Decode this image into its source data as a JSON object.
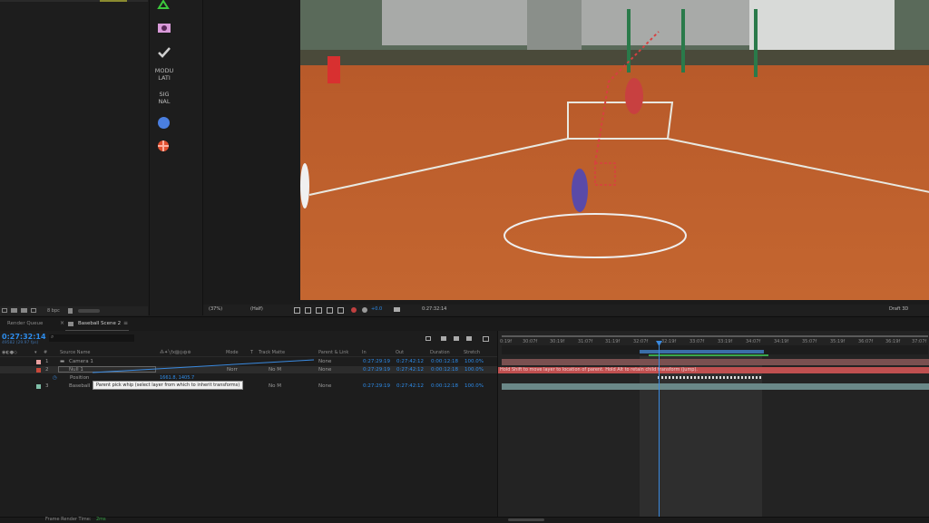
{
  "tools": {
    "labels": [
      "MODU\nLATI",
      "SIG\nNAL"
    ]
  },
  "viewer": {
    "zoom": "(37%)",
    "quality": "(Half)",
    "exposure": "+0.0",
    "timecode": "0:27:32:14",
    "renderer": "Draft 3D",
    "bpc": "8 bpc"
  },
  "tabs": {
    "render_queue": "Render Queue",
    "comp": "Baseball Scene 2"
  },
  "timeline": {
    "current_time": "0:27:32:14",
    "frame_info": "49582 (29.97 fps)",
    "columns": {
      "source_name": "Source Name",
      "mode": "Mode",
      "t": "T",
      "track_matte": "Track Matte",
      "parent": "Parent & Link",
      "in": "In",
      "out": "Out",
      "duration": "Duration",
      "stretch": "Stretch"
    },
    "layers": [
      {
        "num": "1",
        "name": "Camera 1",
        "parent": "None",
        "in": "0:27:29:19",
        "out": "0:27:42:12",
        "duration": "0:00:12:18",
        "stretch": "100.0%",
        "color": "#e8a0a0"
      },
      {
        "num": "2",
        "name": "Null 1",
        "mode": "Norr",
        "matte": "No M",
        "parent": "None",
        "in": "0:27:29:19",
        "out": "0:27:42:12",
        "duration": "0:00:12:18",
        "stretch": "100.0%",
        "color": "#c8483a"
      },
      {
        "num": "3",
        "name": "Baseball",
        "mode": "Norr",
        "matte": "No M",
        "parent": "None",
        "in": "0:27:29:19",
        "out": "0:27:42:12",
        "duration": "0:00:12:18",
        "stretch": "100.0%",
        "color": "#7fbfa8"
      }
    ],
    "position_label": "Position",
    "position_value": "1661.8, 1405.7",
    "tooltip": "Parent pick whip (select layer from which to inherit transforms)",
    "hint": "Hold Shift to move layer to location of parent. Hold Alt to retain child transform (jump).",
    "ruler": [
      "0:19f",
      "30:07f",
      "30:19f",
      "31:07f",
      "31:19f",
      "32:07f",
      "32:19f",
      "33:07f",
      "33:19f",
      "34:07f",
      "34:19f",
      "35:07f",
      "35:19f",
      "36:07f",
      "36:19f",
      "37:07f"
    ],
    "render_time_label": "Frame Render Time:",
    "render_time_value": "2ms"
  },
  "colors": {
    "accent": "#2d8ceb",
    "layer_bar": "#c05050",
    "work_area": "#3a6ea8",
    "keyframe_bar": "#3aa84a"
  }
}
